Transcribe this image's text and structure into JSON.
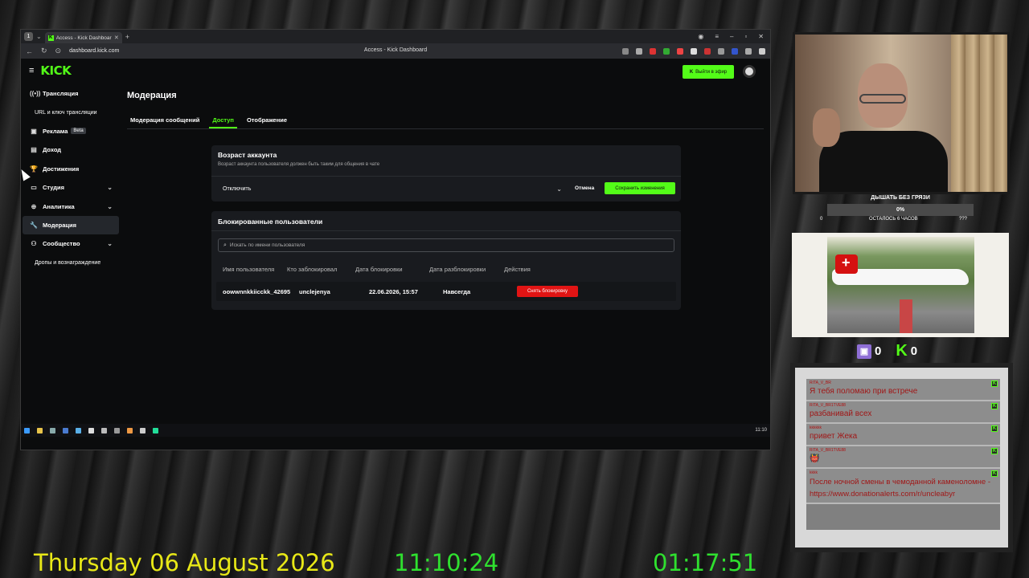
{
  "browser": {
    "tab_title": "Access - Kick Dashboard",
    "url": "dashboard.kick.com",
    "page_title": "Access - Kick Dashboard"
  },
  "header": {
    "logo": "KICK",
    "go_live": "Выйти в эфир"
  },
  "sidebar": {
    "items": [
      {
        "label": "Трансляция",
        "icon": "broadcast-icon"
      },
      {
        "label": "URL и ключ трансляции"
      },
      {
        "label": "Реклама",
        "badge": "Beta",
        "icon": "ads-icon"
      },
      {
        "label": "Доход",
        "icon": "income-icon"
      },
      {
        "label": "Достижения",
        "icon": "trophy-icon"
      },
      {
        "label": "Студия",
        "icon": "studio-icon"
      },
      {
        "label": "Аналитика",
        "icon": "analytics-icon"
      },
      {
        "label": "Модерация",
        "icon": "wrench-icon"
      },
      {
        "label": "Сообщество",
        "icon": "community-icon"
      },
      {
        "label": "Дропы и вознаграждение"
      }
    ]
  },
  "main": {
    "title": "Модерация",
    "tabs": [
      "Модерация сообщений",
      "Доступ",
      "Отображение"
    ],
    "account_age": {
      "title": "Возраст аккаунта",
      "description": "Возраст аккаунта пользователя должен быть таким для общения в чате",
      "selected": "Отключить",
      "cancel": "Отмена",
      "save": "Сохранить изменения"
    },
    "blocked": {
      "title": "Блокированные пользователи",
      "search_placeholder": "Искать по имени пользователя",
      "columns": [
        "Имя пользователя",
        "Кто заблокировал",
        "Дата блокировки",
        "Дата разблокировки",
        "Действия"
      ],
      "rows": [
        {
          "user": "oowwnnkkiicckk_42695",
          "by": "unclejenya",
          "date": "22.06.2026, 15:57",
          "until": "Навсегда",
          "action": "Снять блокировку"
        }
      ]
    }
  },
  "taskbar": {
    "clock": "11:10"
  },
  "overlay": {
    "goal_title": "ДЫШАТЬ БЕЗ ГРЯЗИ",
    "goal_percent": "0%",
    "goal_left": "0",
    "goal_mid": "ОСТАЛОСЬ 6 ЧАСОВ",
    "goal_right": "???",
    "twitch_count": "0",
    "kick_count": "0",
    "chat": [
      {
        "user": "RITA_V_BR",
        "text": "Я тебя поломаю при встрече"
      },
      {
        "user": "RITA_V_BR1TVE88",
        "text": "разбанивай всех"
      },
      {
        "user": "kkkkkk",
        "text": "привет Жека"
      },
      {
        "user": "RITA_V_BR1TVE88",
        "text": "👹"
      },
      {
        "user": "kkkk",
        "text": "После ночной смены в чемоданной каменоломне - https://www.donationalerts.com/r/uncleabyr"
      }
    ],
    "date": "Thursday 06 August 2026",
    "time": "11:10:24",
    "elapsed": "01:17:51"
  },
  "colors": {
    "kick_green": "#53fc18",
    "danger": "#e11414",
    "date_yellow": "#e8e817"
  }
}
